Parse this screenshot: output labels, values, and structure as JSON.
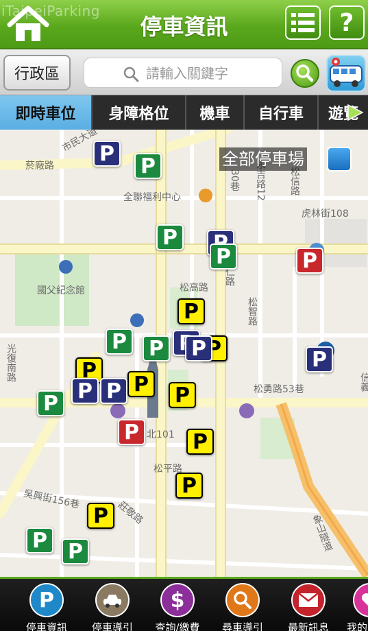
{
  "header": {
    "watermark": "iTaipeiParking",
    "title": "停車資訊",
    "help_label": "?"
  },
  "search": {
    "district_label": "行政區",
    "placeholder": "請輸入關鍵字"
  },
  "tabs": [
    {
      "label": "即時車位",
      "active": true
    },
    {
      "label": "身障格位",
      "active": false
    },
    {
      "label": "機車",
      "active": false
    },
    {
      "label": "自行車",
      "active": false
    },
    {
      "label": "遊覽",
      "active": false
    }
  ],
  "map": {
    "all_lots_label": "全部停車場",
    "labels": {
      "shimin": "市民大道",
      "yanchang": "菸廠路",
      "quanlian": "全聯福利中心",
      "xiangya": "30巷",
      "yongji": "永吉路12",
      "songxin": "松信路",
      "hulin": "虎林街108",
      "guofu": "國父紀念館",
      "songgao": "松高路",
      "songren": "松仁路",
      "songzhi": "松智路",
      "songyong": "松勇路53巷",
      "guangfu": "光復南路",
      "taipei101": "北101",
      "songping": "松平路",
      "wuxing": "吳興街156巷",
      "zhuangjing": "莊敬路",
      "xiangshan": "象山隧道",
      "xinyi": "信義"
    },
    "markers": [
      {
        "color": "blue"
      },
      {
        "color": "green"
      },
      {
        "color": "green"
      },
      {
        "color": "blue"
      },
      {
        "color": "green"
      },
      {
        "color": "red"
      },
      {
        "color": "yellow"
      },
      {
        "color": "green"
      },
      {
        "color": "green"
      },
      {
        "color": "yellow"
      },
      {
        "color": "blue"
      },
      {
        "color": "blue"
      },
      {
        "color": "yellow"
      },
      {
        "color": "yellow"
      },
      {
        "color": "blue"
      },
      {
        "color": "blue"
      },
      {
        "color": "yellow"
      },
      {
        "color": "green"
      },
      {
        "color": "yellow"
      },
      {
        "color": "red"
      },
      {
        "color": "yellow"
      },
      {
        "color": "yellow"
      },
      {
        "color": "green"
      },
      {
        "color": "green"
      },
      {
        "color": "blue"
      }
    ],
    "marker_letter": "P"
  },
  "bottom_nav": [
    {
      "label": "停車資訊",
      "icon": "parking-icon",
      "color": "#1e88c8"
    },
    {
      "label": "停車導引",
      "icon": "car-guide-icon",
      "color": "#8a7a62"
    },
    {
      "label": "查詢/繳費",
      "icon": "dollar-icon",
      "color": "#8c2f9a"
    },
    {
      "label": "尋車導引",
      "icon": "magnifier-icon",
      "color": "#e0781a"
    },
    {
      "label": "最新訊息",
      "icon": "mail-icon",
      "color": "#c4232b"
    },
    {
      "label": "我的",
      "icon": "heart-icon",
      "color": "#d8329a"
    }
  ],
  "icons": {
    "dollar": "$",
    "parking": "P"
  }
}
